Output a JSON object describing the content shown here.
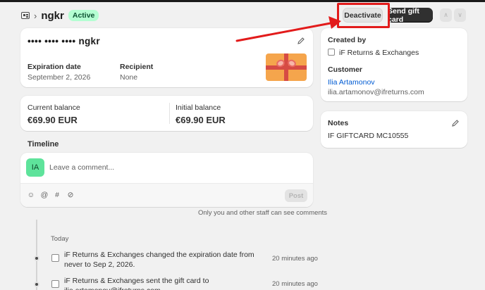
{
  "header": {
    "title": "ngkr",
    "status_badge": "Active",
    "deactivate_label": "Deactivate",
    "send_label": "Send gift card",
    "prev_glyph": "∧",
    "next_glyph": "∨"
  },
  "gift_card": {
    "masked_code": "•••• •••• •••• ngkr",
    "expiration_label": "Expiration date",
    "expiration_value": "September 2, 2026",
    "recipient_label": "Recipient",
    "recipient_value": "None"
  },
  "balance": {
    "current_label": "Current balance",
    "current_value": "€69.90 EUR",
    "initial_label": "Initial balance",
    "initial_value": "€69.90 EUR"
  },
  "timeline": {
    "title": "Timeline",
    "avatar_initials": "IA",
    "comment_placeholder": "Leave a comment...",
    "post_label": "Post",
    "staff_note": "Only you and other staff can see comments",
    "date_group": "Today",
    "events": [
      {
        "text": "iF Returns & Exchanges changed the expiration date from never to Sep 2, 2026.",
        "time": "20 minutes ago"
      },
      {
        "text": "iF Returns & Exchanges sent the gift card to ilia.artamonov@ifreturns.com",
        "time": "20 minutes ago"
      }
    ]
  },
  "sidebar": {
    "created_by_label": "Created by",
    "created_by_value": "iF Returns & Exchanges",
    "customer_label": "Customer",
    "customer_name": "Ilia Artamonov",
    "customer_email": "ilia.artamonov@ifreturns.com",
    "notes_label": "Notes",
    "notes_value": "IF GIFTCARD MC10555"
  },
  "colors": {
    "active_badge_bg": "#b4fed2",
    "link": "#005bd3",
    "primary_button": "#303030",
    "annotation": "#e21b1b"
  }
}
